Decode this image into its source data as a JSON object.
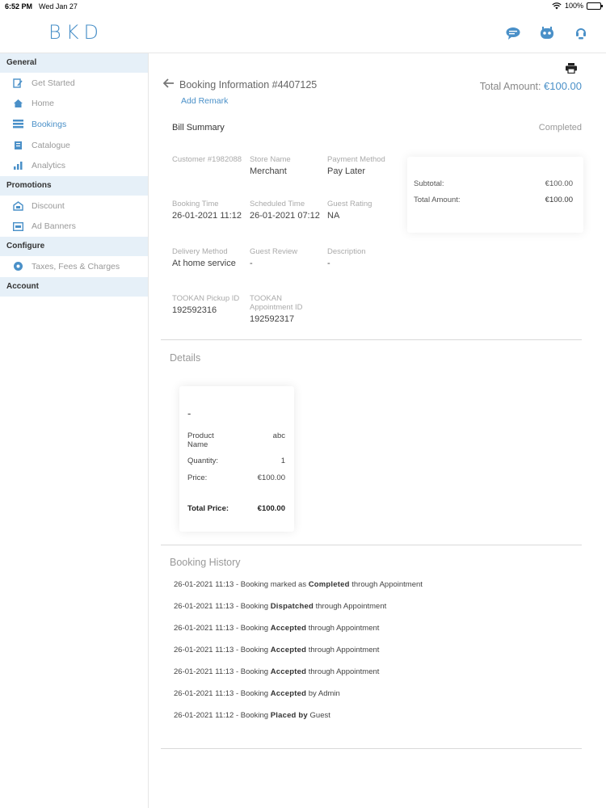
{
  "status_bar": {
    "time": "6:52 PM",
    "date": "Wed Jan 27",
    "battery": "100%"
  },
  "header": {
    "logo": "BKD",
    "icons": [
      "chat-icon",
      "bot-icon",
      "support-icon"
    ]
  },
  "sidebar": {
    "sections": [
      {
        "title": "General",
        "items": [
          {
            "label": "Get Started",
            "icon": "get-started-icon",
            "active": false
          },
          {
            "label": "Home",
            "icon": "home-icon",
            "active": false
          },
          {
            "label": "Bookings",
            "icon": "bookings-icon",
            "active": true
          },
          {
            "label": "Catalogue",
            "icon": "catalogue-icon",
            "active": false
          },
          {
            "label": "Analytics",
            "icon": "analytics-icon",
            "active": false
          }
        ]
      },
      {
        "title": "Promotions",
        "items": [
          {
            "label": "Discount",
            "icon": "discount-icon",
            "active": false
          },
          {
            "label": "Ad Banners",
            "icon": "ad-banners-icon",
            "active": false
          }
        ]
      },
      {
        "title": "Configure",
        "items": [
          {
            "label": "Taxes, Fees & Charges",
            "icon": "taxes-icon",
            "active": false
          }
        ]
      },
      {
        "title": "Account",
        "items": []
      }
    ]
  },
  "booking": {
    "title": "Booking Information #4407125",
    "add_remark": "Add Remark",
    "total_amount_label": "Total Amount:",
    "total_amount_value": "€100.00",
    "bill_summary": "Bill Summary",
    "status": "Completed",
    "fields": {
      "customer": {
        "label": "Customer #1982088",
        "value": ""
      },
      "store_name": {
        "label": "Store Name",
        "value": "Merchant"
      },
      "payment_method": {
        "label": "Payment Method",
        "value": "Pay Later"
      },
      "booking_time": {
        "label": "Booking Time",
        "value": "26-01-2021 11:12"
      },
      "scheduled_time": {
        "label": "Scheduled Time",
        "value": "26-01-2021 07:12"
      },
      "guest_rating": {
        "label": "Guest Rating",
        "value": "NA"
      },
      "delivery_method": {
        "label": "Delivery Method",
        "value": "At home service"
      },
      "guest_review": {
        "label": "Guest Review",
        "value": "-"
      },
      "description": {
        "label": "Description",
        "value": "-"
      },
      "pickup_id": {
        "label": "TOOKAN Pickup ID",
        "value": "192592316"
      },
      "appointment_id": {
        "label": "TOOKAN Appointment ID",
        "value": "192592317"
      }
    },
    "summary": {
      "subtotal_label": "Subtotal:",
      "subtotal_value": "€100.00",
      "total_label": "Total Amount:",
      "total_value": "€100.00"
    }
  },
  "details": {
    "title": "Details",
    "product": {
      "heading": "-",
      "name_label": "Product Name",
      "name_value": "abc",
      "quantity_label": "Quantity:",
      "quantity_value": "1",
      "price_label": "Price:",
      "price_value": "€100.00",
      "total_label": "Total Price:",
      "total_value": "€100.00"
    }
  },
  "history": {
    "title": "Booking History",
    "entries": [
      {
        "time": "26-01-2021 11:13",
        "pre": " - Booking marked as ",
        "bold": "Completed",
        "post": " through Appointment"
      },
      {
        "time": "26-01-2021 11:13",
        "pre": " - Booking ",
        "bold": "Dispatched",
        "post": " through Appointment"
      },
      {
        "time": "26-01-2021 11:13",
        "pre": " - Booking ",
        "bold": "Accepted",
        "post": " through Appointment"
      },
      {
        "time": "26-01-2021 11:13",
        "pre": " - Booking ",
        "bold": "Accepted",
        "post": " through Appointment"
      },
      {
        "time": "26-01-2021 11:13",
        "pre": " - Booking ",
        "bold": "Accepted",
        "post": " through Appointment"
      },
      {
        "time": "26-01-2021 11:13",
        "pre": " - Booking ",
        "bold": "Accepted",
        "post": " by Admin"
      },
      {
        "time": "26-01-2021 11:12",
        "pre": " - Booking ",
        "bold": "Placed by",
        "post": " Guest"
      }
    ]
  },
  "colors": {
    "accent": "#4a90c8",
    "section_bg": "#e6f0f8",
    "muted": "#999999"
  }
}
